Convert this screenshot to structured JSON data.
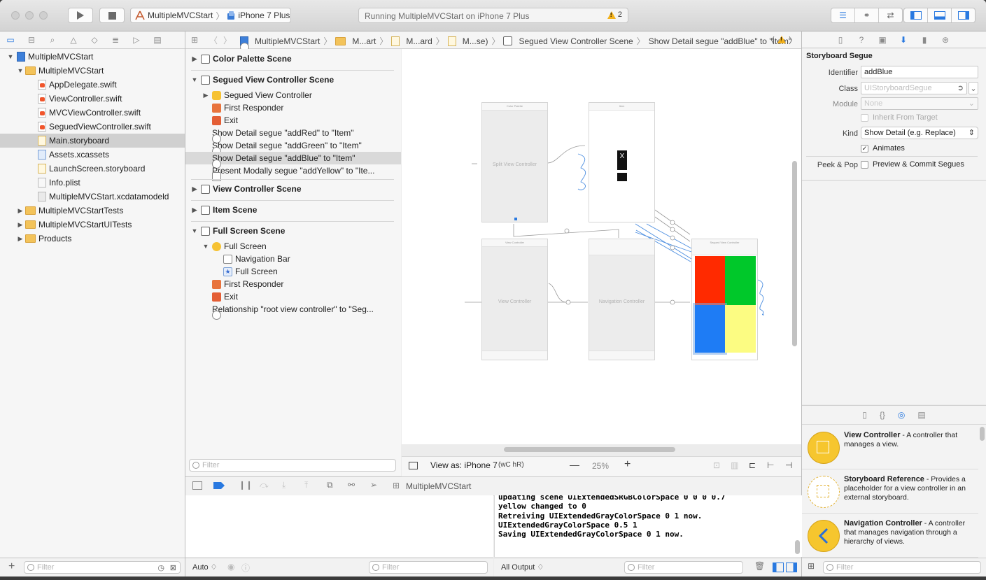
{
  "toolbar": {
    "scheme_app": "MultipleMVCStart",
    "scheme_device": "iPhone 7 Plus",
    "activity_text": "Running MultipleMVCStart on iPhone 7 Plus",
    "warning_count": "2"
  },
  "jumpbar": {
    "items": [
      "MultipleMVCStart",
      "M...art",
      "M...ard",
      "M...se)",
      "Segued View Controller Scene",
      "Show Detail segue \"addBlue\" to \"Item\""
    ]
  },
  "navigator": {
    "items": [
      {
        "label": "MultipleMVCStart",
        "type": "project",
        "depth": 0,
        "open": true
      },
      {
        "label": "MultipleMVCStart",
        "type": "folder",
        "depth": 1,
        "open": true
      },
      {
        "label": "AppDelegate.swift",
        "type": "swift",
        "depth": 2
      },
      {
        "label": "ViewController.swift",
        "type": "swift",
        "depth": 2
      },
      {
        "label": "MVCViewController.swift",
        "type": "swift",
        "depth": 2
      },
      {
        "label": "SeguedViewController.swift",
        "type": "swift",
        "depth": 2
      },
      {
        "label": "Main.storyboard",
        "type": "storyboard",
        "depth": 2,
        "selected": true
      },
      {
        "label": "Assets.xcassets",
        "type": "assets",
        "depth": 2
      },
      {
        "label": "LaunchScreen.storyboard",
        "type": "storyboard",
        "depth": 2
      },
      {
        "label": "Info.plist",
        "type": "plist",
        "depth": 2
      },
      {
        "label": "MultipleMVCStart.xcdatamodeld",
        "type": "datamodel",
        "depth": 2
      },
      {
        "label": "MultipleMVCStartTests",
        "type": "folder",
        "depth": 1,
        "open": false
      },
      {
        "label": "MultipleMVCStartUITests",
        "type": "folder",
        "depth": 1,
        "open": false
      },
      {
        "label": "Products",
        "type": "folder",
        "depth": 1,
        "open": false
      }
    ],
    "filter_placeholder": "Filter"
  },
  "outline": {
    "rows": [
      {
        "label": "Color Palette Scene",
        "kind": "scene",
        "depth": 0,
        "open": false
      },
      {
        "label": "Segued View Controller Scene",
        "kind": "scene",
        "depth": 0,
        "open": true
      },
      {
        "label": "Segued View Controller",
        "kind": "vc",
        "depth": 1,
        "disclosure": "closed"
      },
      {
        "label": "First Responder",
        "kind": "fr",
        "depth": 1
      },
      {
        "label": "Exit",
        "kind": "ex",
        "depth": 1
      },
      {
        "label": "Show Detail segue \"addRed\" to \"Item\"",
        "kind": "seg",
        "depth": 1
      },
      {
        "label": "Show Detail segue \"addGreen\" to \"Item\"",
        "kind": "seg",
        "depth": 1
      },
      {
        "label": "Show Detail segue \"addBlue\" to \"Item\"",
        "kind": "seg",
        "depth": 1,
        "selected": true
      },
      {
        "label": "Present Modally segue \"addYellow\" to \"Ite...",
        "kind": "seg",
        "depth": 1
      },
      {
        "label": "View Controller Scene",
        "kind": "scene",
        "depth": 0,
        "open": false
      },
      {
        "label": "Item Scene",
        "kind": "scene",
        "depth": 0,
        "open": false
      },
      {
        "label": "Full Screen Scene",
        "kind": "scene",
        "depth": 0,
        "open": true
      },
      {
        "label": "Full Screen",
        "kind": "vc",
        "depth": 1,
        "disclosure": "open"
      },
      {
        "label": "Navigation Bar",
        "kind": "nb",
        "depth": 2
      },
      {
        "label": "Full Screen",
        "kind": "star",
        "depth": 2
      },
      {
        "label": "First Responder",
        "kind": "fr",
        "depth": 1
      },
      {
        "label": "Exit",
        "kind": "ex",
        "depth": 1
      },
      {
        "label": "Relationship \"root view controller\" to \"Seg...",
        "kind": "seg",
        "depth": 1
      }
    ],
    "filter_placeholder": "Filter"
  },
  "canvas": {
    "scenes": [
      {
        "title": "Color Palette",
        "label": "Split View Controller"
      },
      {
        "title": "Item",
        "label": ""
      },
      {
        "title": "View Controller",
        "label": "View Controller"
      },
      {
        "title": "",
        "label": "Navigation Controller"
      },
      {
        "title": "Segued View Controller",
        "label": ""
      }
    ],
    "palette_colors": [
      "#ff2a00",
      "#00c82a",
      "#1e7cf5",
      "#fcfc82"
    ],
    "footer": {
      "view_as": "View as: iPhone 7",
      "size_class": "(wC hR)",
      "zoom": "25%"
    }
  },
  "debug": {
    "target_label": "MultipleMVCStart",
    "console_lines": [
      "updating scene UIExtendedSRGBColorSpace 0 0 0 0.7",
      "yellow changed to 0",
      "Retreiving UIExtendedGrayColorSpace 0 1 now.",
      "UIExtendedGrayColorSpace 0.5 1",
      "Saving UIExtendedGrayColorSpace 0 1 now."
    ],
    "auto_label": "Auto ♢",
    "output_label": "All Output ♢",
    "filter_placeholder": "Filter"
  },
  "inspector": {
    "title": "Storyboard Segue",
    "identifier_label": "Identifier",
    "identifier_value": "addBlue",
    "class_label": "Class",
    "class_placeholder": "UIStoryboardSegue",
    "module_label": "Module",
    "module_placeholder": "None",
    "inherit_label": "Inherit From Target",
    "kind_label": "Kind",
    "kind_value": "Show Detail (e.g. Replace)",
    "animates_label": "Animates",
    "peek_label": "Peek & Pop",
    "preview_label": "Preview & Commit Segues"
  },
  "library": {
    "items": [
      {
        "name": "View Controller",
        "desc": " - A controller that manages a view."
      },
      {
        "name": "Storyboard Reference",
        "desc": " - Provides a placeholder for a view controller in an external storyboard."
      },
      {
        "name": "Navigation Controller",
        "desc": " - A controller that manages navigation through a hierarchy of views."
      }
    ],
    "filter_placeholder": "Filter"
  }
}
